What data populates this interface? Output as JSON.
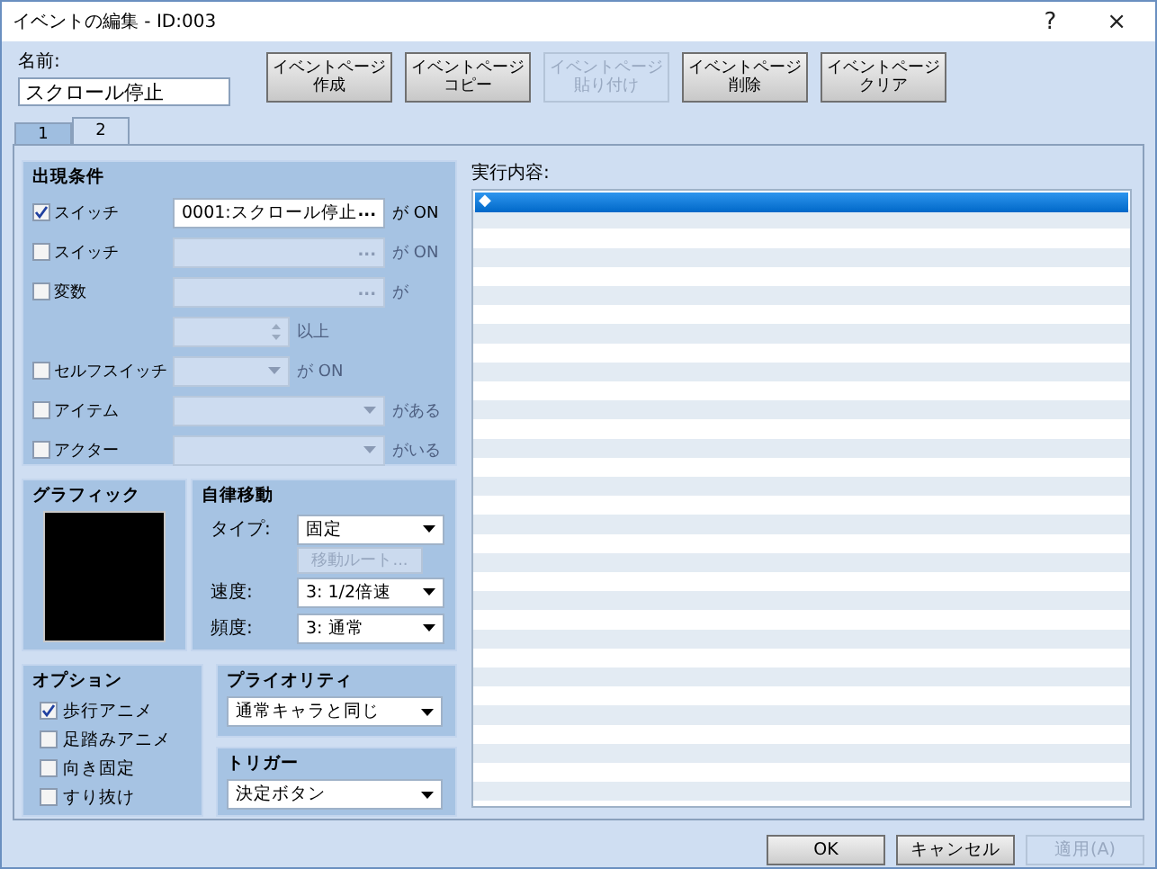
{
  "window": {
    "title": "イベントの編集 - ID:003",
    "help": "?",
    "close": "×"
  },
  "name": {
    "label": "名前:",
    "value": "スクロール停止"
  },
  "page_buttons": [
    {
      "lines": [
        "イベントページ",
        "作成"
      ],
      "disabled": false
    },
    {
      "lines": [
        "イベントページ",
        "コピー"
      ],
      "disabled": false
    },
    {
      "lines": [
        "イベントページ",
        "貼り付け"
      ],
      "disabled": true
    },
    {
      "lines": [
        "イベントページ",
        "削除"
      ],
      "disabled": false
    },
    {
      "lines": [
        "イベントページ",
        "クリア"
      ],
      "disabled": false
    }
  ],
  "tabs": [
    {
      "label": "1",
      "selected": false
    },
    {
      "label": "2",
      "selected": true
    }
  ],
  "conditions": {
    "title": "出現条件",
    "rows": [
      {
        "kind": "picker",
        "label": "スイッチ",
        "checked": true,
        "disabled": false,
        "value": "0001:スクロール停止",
        "button": "...",
        "suffix": "が ON"
      },
      {
        "kind": "picker",
        "label": "スイッチ",
        "checked": false,
        "disabled": true,
        "button": "...",
        "suffix": "が ON"
      },
      {
        "kind": "picker",
        "label": "変数",
        "checked": false,
        "disabled": true,
        "button": "...",
        "suffix": "が"
      },
      {
        "kind": "spinner",
        "disabled": true,
        "suffix": "以上"
      },
      {
        "kind": "dropdown",
        "label": "セルフスイッチ",
        "checked": false,
        "disabled": true,
        "suffix": "が ON"
      },
      {
        "kind": "wide-dropdown",
        "label": "アイテム",
        "checked": false,
        "disabled": true,
        "suffix": "がある"
      },
      {
        "kind": "wide-dropdown",
        "label": "アクター",
        "checked": false,
        "disabled": true,
        "suffix": "がいる"
      }
    ]
  },
  "graphic": {
    "title": "グラフィック"
  },
  "movement": {
    "title": "自律移動",
    "type_label": "タイプ:",
    "type_value": "固定",
    "route_button": {
      "label": "移動ルート...",
      "disabled": true
    },
    "speed_label": "速度:",
    "speed_value": "3: 1/2倍速",
    "frequency_label": "頻度:",
    "frequency_value": "3: 通常"
  },
  "options": {
    "title": "オプション",
    "items": [
      {
        "label": "歩行アニメ",
        "checked": true
      },
      {
        "label": "足踏みアニメ",
        "checked": false
      },
      {
        "label": "向き固定",
        "checked": false
      },
      {
        "label": "すり抜け",
        "checked": false
      }
    ]
  },
  "priority": {
    "title": "プライオリティ",
    "value": "通常キャラと同じ"
  },
  "trigger": {
    "title": "トリガー",
    "value": "決定ボタン"
  },
  "commands": {
    "label": "実行内容:",
    "items": [
      {
        "text": "◆",
        "selected": true
      }
    ]
  },
  "footer_buttons": [
    {
      "label": "OK",
      "disabled": false
    },
    {
      "label": "キャンセル",
      "disabled": false
    },
    {
      "label": "適用(A)",
      "disabled": true
    }
  ]
}
